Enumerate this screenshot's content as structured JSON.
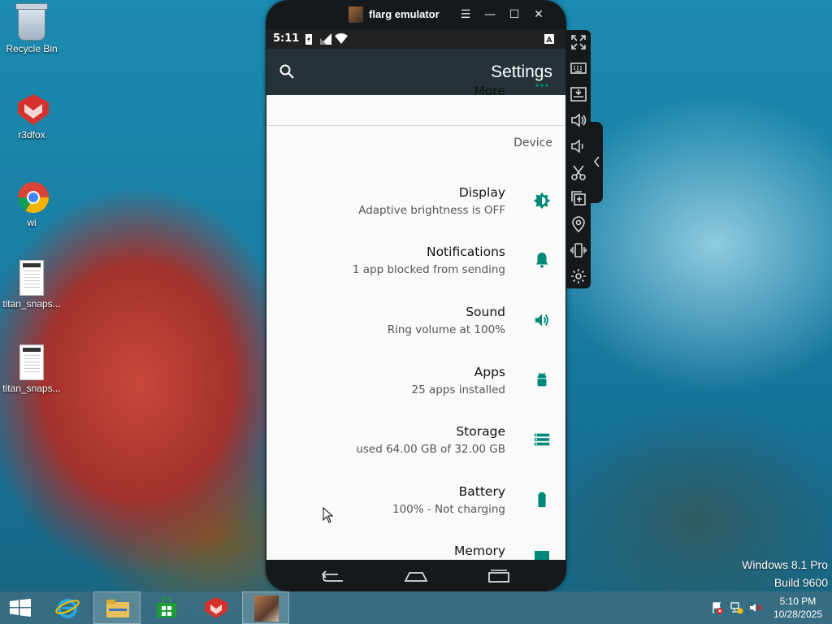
{
  "desktop": {
    "icons": [
      {
        "label": "Recycle Bin"
      },
      {
        "label": "r3dfox"
      },
      {
        "label": "wi"
      },
      {
        "label": "titan_snaps..."
      },
      {
        "label": "titan_snaps..."
      }
    ]
  },
  "emulator": {
    "title": "flarg emulator",
    "status_bar": {
      "time": "5:11"
    },
    "app_bar": {
      "title": "Settings",
      "search_icon": "search-icon"
    },
    "partial_item_top": {
      "title": "More"
    },
    "section_header": "Device",
    "items": [
      {
        "title": "Display",
        "subtitle": "Adaptive brightness is OFF",
        "icon": "brightness-icon"
      },
      {
        "title": "Notifications",
        "subtitle": "1 app blocked from sending",
        "icon": "bell-icon"
      },
      {
        "title": "Sound",
        "subtitle": "Ring volume at 100%",
        "icon": "volume-icon"
      },
      {
        "title": "Apps",
        "subtitle": "25 apps installed",
        "icon": "android-icon"
      },
      {
        "title": "Storage",
        "subtitle": "used 64.00 GB of 32.00 GB",
        "icon": "storage-icon"
      },
      {
        "title": "Battery",
        "subtitle": "100% - Not charging",
        "icon": "battery-icon"
      }
    ],
    "partial_item_bottom": {
      "title": "Memory"
    },
    "side_toolbar": [
      "fullscreen-icon",
      "keyboard-icon",
      "apk-install-icon",
      "volume-up-icon",
      "volume-down-icon",
      "screenshot-icon",
      "copy-icon",
      "location-icon",
      "shake-icon",
      "settings-icon"
    ]
  },
  "watermark": {
    "line1": "Windows 8.1 Pro",
    "line2": "Build 9600"
  },
  "taskbar": {
    "time": "5:10 PM",
    "date": "10/28/2025"
  },
  "colors": {
    "accent": "#00897b",
    "appbar": "#263238",
    "statusbar": "#212121"
  }
}
